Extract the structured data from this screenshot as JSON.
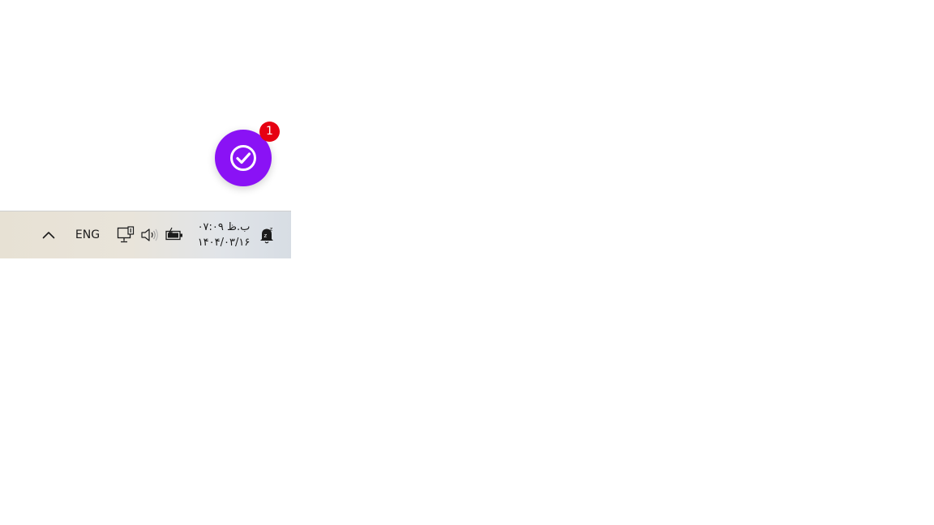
{
  "fab": {
    "icon": "check-circle-icon",
    "badge_count": "1",
    "color": "#8a12f5",
    "badge_color": "#e60012"
  },
  "taskbar": {
    "overflow_icon": "chevron-up-icon",
    "language": "ENG",
    "network_icon": "network-monitor-icon",
    "volume_icon": "speaker-icon",
    "battery_icon": "battery-charging-icon",
    "clock": {
      "time": "۰۷:۰۹ ب.ظ",
      "date": "۱۴۰۴/۰۳/۱۶"
    },
    "notification_icon": "notification-bell-snooze-icon"
  }
}
